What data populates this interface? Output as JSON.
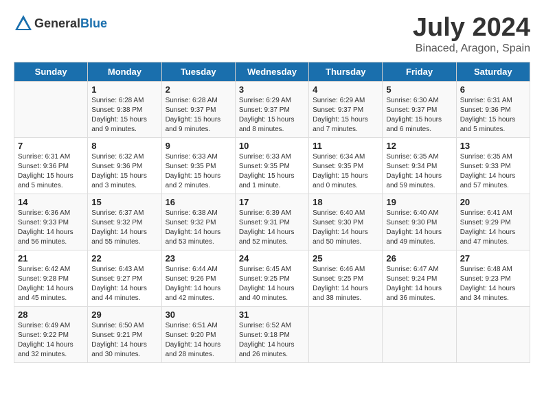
{
  "header": {
    "logo_general": "General",
    "logo_blue": "Blue",
    "main_title": "July 2024",
    "subtitle": "Binaced, Aragon, Spain"
  },
  "days_of_week": [
    "Sunday",
    "Monday",
    "Tuesday",
    "Wednesday",
    "Thursday",
    "Friday",
    "Saturday"
  ],
  "weeks": [
    [
      {
        "day": "",
        "sunrise": "",
        "sunset": "",
        "daylight": ""
      },
      {
        "day": "1",
        "sunrise": "Sunrise: 6:28 AM",
        "sunset": "Sunset: 9:38 PM",
        "daylight": "Daylight: 15 hours and 9 minutes."
      },
      {
        "day": "2",
        "sunrise": "Sunrise: 6:28 AM",
        "sunset": "Sunset: 9:37 PM",
        "daylight": "Daylight: 15 hours and 9 minutes."
      },
      {
        "day": "3",
        "sunrise": "Sunrise: 6:29 AM",
        "sunset": "Sunset: 9:37 PM",
        "daylight": "Daylight: 15 hours and 8 minutes."
      },
      {
        "day": "4",
        "sunrise": "Sunrise: 6:29 AM",
        "sunset": "Sunset: 9:37 PM",
        "daylight": "Daylight: 15 hours and 7 minutes."
      },
      {
        "day": "5",
        "sunrise": "Sunrise: 6:30 AM",
        "sunset": "Sunset: 9:37 PM",
        "daylight": "Daylight: 15 hours and 6 minutes."
      },
      {
        "day": "6",
        "sunrise": "Sunrise: 6:31 AM",
        "sunset": "Sunset: 9:36 PM",
        "daylight": "Daylight: 15 hours and 5 minutes."
      }
    ],
    [
      {
        "day": "7",
        "sunrise": "Sunrise: 6:31 AM",
        "sunset": "Sunset: 9:36 PM",
        "daylight": "Daylight: 15 hours and 5 minutes."
      },
      {
        "day": "8",
        "sunrise": "Sunrise: 6:32 AM",
        "sunset": "Sunset: 9:36 PM",
        "daylight": "Daylight: 15 hours and 3 minutes."
      },
      {
        "day": "9",
        "sunrise": "Sunrise: 6:33 AM",
        "sunset": "Sunset: 9:35 PM",
        "daylight": "Daylight: 15 hours and 2 minutes."
      },
      {
        "day": "10",
        "sunrise": "Sunrise: 6:33 AM",
        "sunset": "Sunset: 9:35 PM",
        "daylight": "Daylight: 15 hours and 1 minute."
      },
      {
        "day": "11",
        "sunrise": "Sunrise: 6:34 AM",
        "sunset": "Sunset: 9:35 PM",
        "daylight": "Daylight: 15 hours and 0 minutes."
      },
      {
        "day": "12",
        "sunrise": "Sunrise: 6:35 AM",
        "sunset": "Sunset: 9:34 PM",
        "daylight": "Daylight: 14 hours and 59 minutes."
      },
      {
        "day": "13",
        "sunrise": "Sunrise: 6:35 AM",
        "sunset": "Sunset: 9:33 PM",
        "daylight": "Daylight: 14 hours and 57 minutes."
      }
    ],
    [
      {
        "day": "14",
        "sunrise": "Sunrise: 6:36 AM",
        "sunset": "Sunset: 9:33 PM",
        "daylight": "Daylight: 14 hours and 56 minutes."
      },
      {
        "day": "15",
        "sunrise": "Sunrise: 6:37 AM",
        "sunset": "Sunset: 9:32 PM",
        "daylight": "Daylight: 14 hours and 55 minutes."
      },
      {
        "day": "16",
        "sunrise": "Sunrise: 6:38 AM",
        "sunset": "Sunset: 9:32 PM",
        "daylight": "Daylight: 14 hours and 53 minutes."
      },
      {
        "day": "17",
        "sunrise": "Sunrise: 6:39 AM",
        "sunset": "Sunset: 9:31 PM",
        "daylight": "Daylight: 14 hours and 52 minutes."
      },
      {
        "day": "18",
        "sunrise": "Sunrise: 6:40 AM",
        "sunset": "Sunset: 9:30 PM",
        "daylight": "Daylight: 14 hours and 50 minutes."
      },
      {
        "day": "19",
        "sunrise": "Sunrise: 6:40 AM",
        "sunset": "Sunset: 9:30 PM",
        "daylight": "Daylight: 14 hours and 49 minutes."
      },
      {
        "day": "20",
        "sunrise": "Sunrise: 6:41 AM",
        "sunset": "Sunset: 9:29 PM",
        "daylight": "Daylight: 14 hours and 47 minutes."
      }
    ],
    [
      {
        "day": "21",
        "sunrise": "Sunrise: 6:42 AM",
        "sunset": "Sunset: 9:28 PM",
        "daylight": "Daylight: 14 hours and 45 minutes."
      },
      {
        "day": "22",
        "sunrise": "Sunrise: 6:43 AM",
        "sunset": "Sunset: 9:27 PM",
        "daylight": "Daylight: 14 hours and 44 minutes."
      },
      {
        "day": "23",
        "sunrise": "Sunrise: 6:44 AM",
        "sunset": "Sunset: 9:26 PM",
        "daylight": "Daylight: 14 hours and 42 minutes."
      },
      {
        "day": "24",
        "sunrise": "Sunrise: 6:45 AM",
        "sunset": "Sunset: 9:25 PM",
        "daylight": "Daylight: 14 hours and 40 minutes."
      },
      {
        "day": "25",
        "sunrise": "Sunrise: 6:46 AM",
        "sunset": "Sunset: 9:25 PM",
        "daylight": "Daylight: 14 hours and 38 minutes."
      },
      {
        "day": "26",
        "sunrise": "Sunrise: 6:47 AM",
        "sunset": "Sunset: 9:24 PM",
        "daylight": "Daylight: 14 hours and 36 minutes."
      },
      {
        "day": "27",
        "sunrise": "Sunrise: 6:48 AM",
        "sunset": "Sunset: 9:23 PM",
        "daylight": "Daylight: 14 hours and 34 minutes."
      }
    ],
    [
      {
        "day": "28",
        "sunrise": "Sunrise: 6:49 AM",
        "sunset": "Sunset: 9:22 PM",
        "daylight": "Daylight: 14 hours and 32 minutes."
      },
      {
        "day": "29",
        "sunrise": "Sunrise: 6:50 AM",
        "sunset": "Sunset: 9:21 PM",
        "daylight": "Daylight: 14 hours and 30 minutes."
      },
      {
        "day": "30",
        "sunrise": "Sunrise: 6:51 AM",
        "sunset": "Sunset: 9:20 PM",
        "daylight": "Daylight: 14 hours and 28 minutes."
      },
      {
        "day": "31",
        "sunrise": "Sunrise: 6:52 AM",
        "sunset": "Sunset: 9:18 PM",
        "daylight": "Daylight: 14 hours and 26 minutes."
      },
      {
        "day": "",
        "sunrise": "",
        "sunset": "",
        "daylight": ""
      },
      {
        "day": "",
        "sunrise": "",
        "sunset": "",
        "daylight": ""
      },
      {
        "day": "",
        "sunrise": "",
        "sunset": "",
        "daylight": ""
      }
    ]
  ]
}
